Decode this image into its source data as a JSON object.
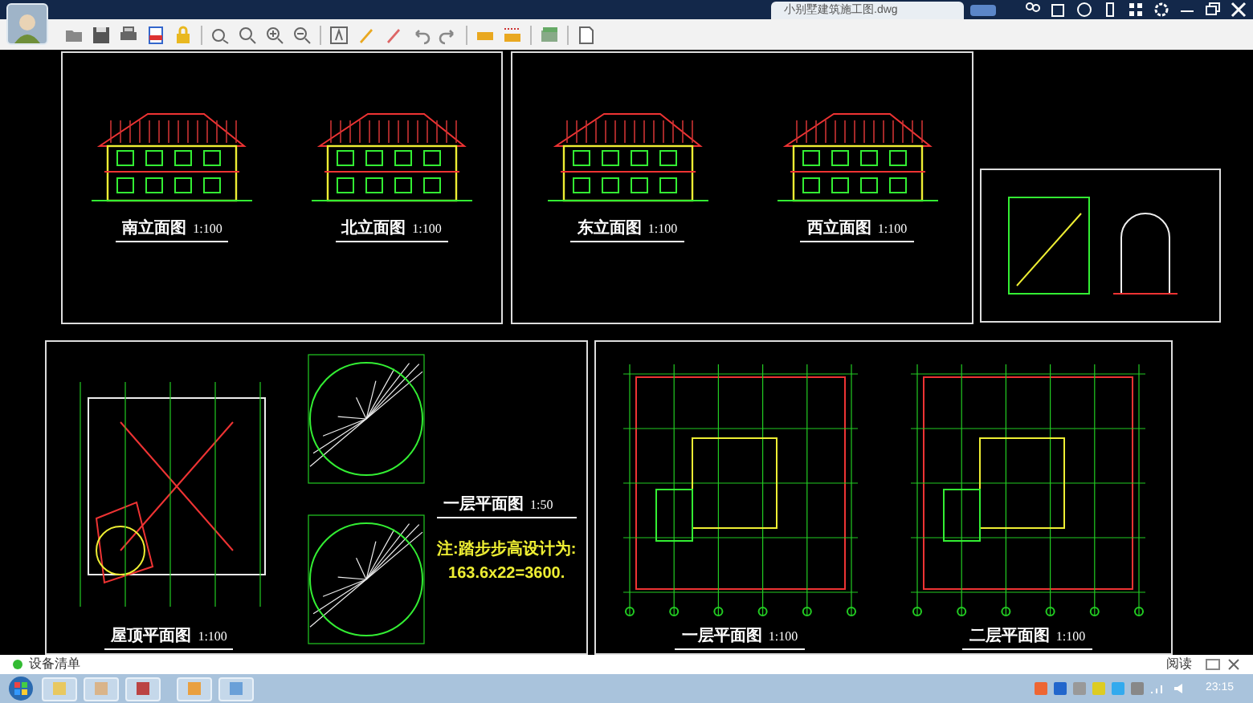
{
  "tab": {
    "label": "小别墅建筑施工图.dwg",
    "selected": true
  },
  "sheets": [
    {
      "kind": "elevations",
      "views": [
        {
          "title": "南立面图",
          "scale": "1:100"
        },
        {
          "title": "北立面图",
          "scale": "1:100"
        }
      ]
    },
    {
      "kind": "elevations",
      "views": [
        {
          "title": "东立面图",
          "scale": "1:100"
        },
        {
          "title": "西立面图",
          "scale": "1:100"
        }
      ]
    },
    {
      "kind": "details"
    },
    {
      "kind": "roof_stair",
      "views": [
        {
          "title": "屋顶平面图",
          "scale": "1:100"
        },
        {
          "title": "一层平面图",
          "scale": "1:50"
        }
      ],
      "note": [
        "注:踏步步高设计为:",
        "163.6x22=3600."
      ]
    },
    {
      "kind": "plans",
      "views": [
        {
          "title": "一层平面图",
          "scale": "1:100"
        },
        {
          "title": "二层平面图",
          "scale": "1:100"
        }
      ]
    }
  ],
  "status_bar": {
    "label": "设备清单",
    "read_button": "阅读"
  },
  "taskbar": {
    "clock": "23:15"
  }
}
